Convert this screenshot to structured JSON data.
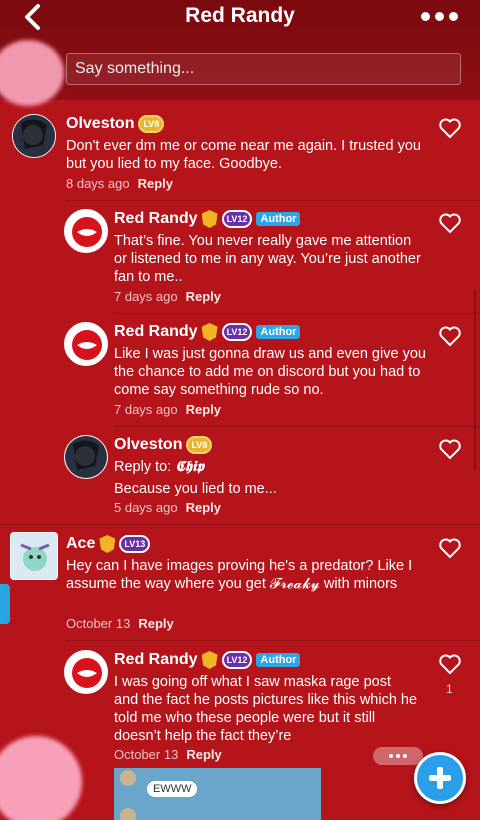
{
  "header": {
    "title": "Red Randy",
    "back_icon": "chevron-left-icon",
    "more_icon": "more-dots-icon",
    "input_placeholder": "Say something..."
  },
  "comments": [
    {
      "user": "Olveston",
      "level": "LV8",
      "text": "Don't ever dm me or come near me again. I trusted you but you lied to my face. Goodbye.",
      "time": "8 days ago",
      "reply": "Reply"
    },
    {
      "user": "Red Randy",
      "level": "LV12",
      "author": "Author",
      "text": "That’s fine. You never really gave me attention or listened to me in any way. You’re just another fan to me..",
      "time": "7 days ago",
      "reply": "Reply"
    },
    {
      "user": "Red Randy",
      "level": "LV12",
      "author": "Author",
      "text": "Like I was just gonna draw us and even give you the chance to add me on discord but you had to come say something rude so no.",
      "time": "7 days ago",
      "reply": "Reply"
    },
    {
      "user": "Olveston",
      "level": "LV8",
      "reply_to_label": "Reply to:",
      "reply_to_name": "𝕮𝖍𝖎𝖕",
      "text": "Because you lied to me...",
      "time": "5 days ago",
      "reply": "Reply"
    },
    {
      "user": "Ace",
      "level": "LV13",
      "text": "Hey can I have images proving he's a predator? Like I assume the way where you get 𝓕𝓻𝓮𝓪𝓴𝔂 with minors",
      "time": "October 13",
      "reply": "Reply"
    },
    {
      "user": "Red Randy",
      "level": "LV12",
      "author": "Author",
      "text": "I was going off what I saw maska rage post and the fact he posts pictures like this which he told me who these people were but it still doesn’t help the fact they’re",
      "time": "October 13",
      "reply": "Reply",
      "likes": "1"
    }
  ],
  "thumb_caption": "EWWW",
  "colors": {
    "bg": "#b5141b",
    "header": "#7a0a0f",
    "author": "#2ea6e6",
    "fab": "#2a9ee8"
  }
}
